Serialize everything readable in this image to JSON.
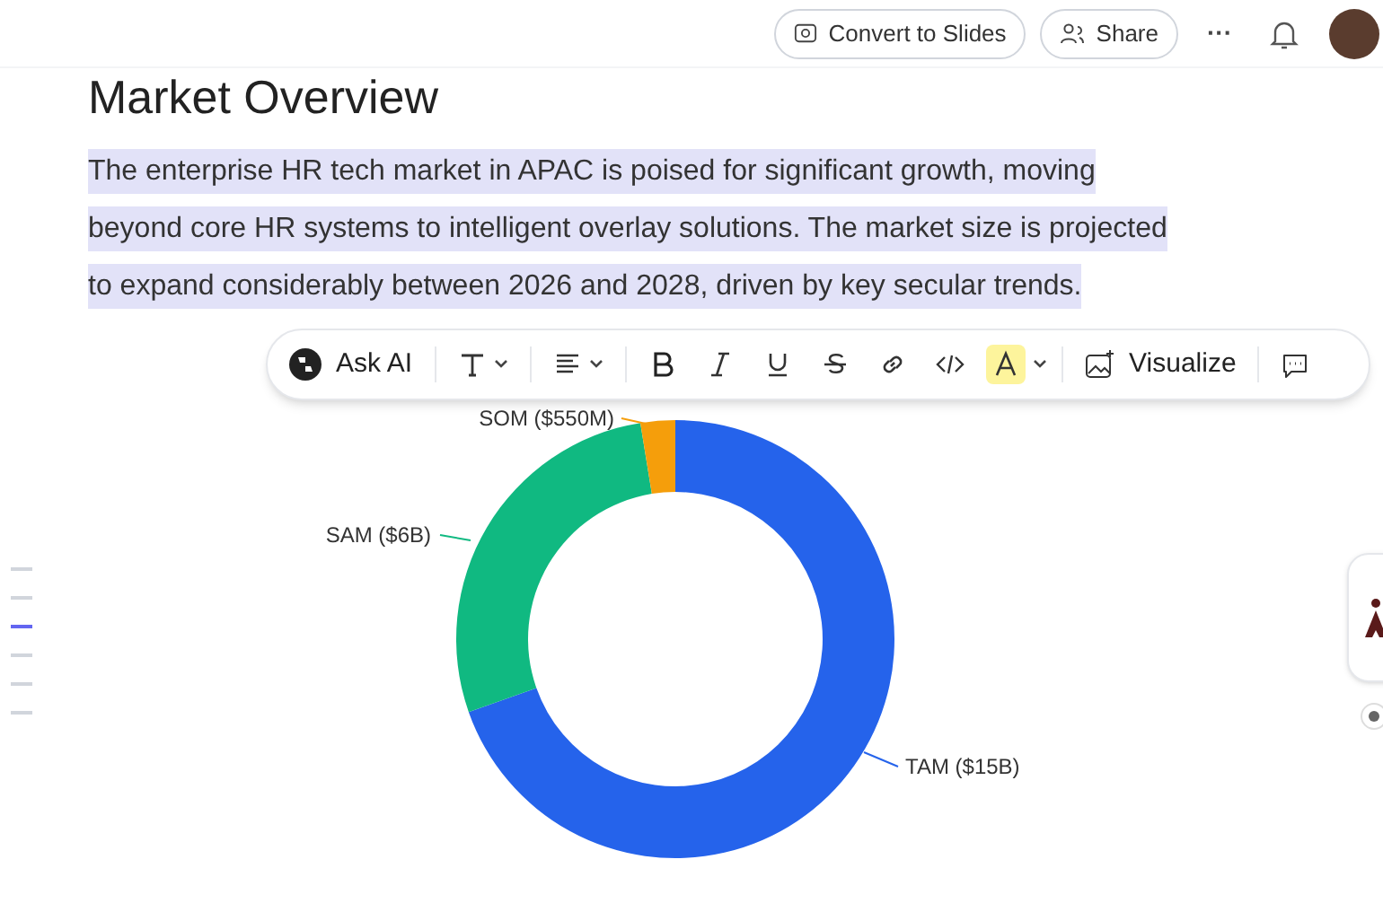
{
  "header": {
    "convert_button": "Convert to Slides",
    "share_button": "Share",
    "more_button": "···"
  },
  "document": {
    "heading": "Market Overview",
    "paragraph": "The enterprise HR tech market in APAC is poised for significant growth, moving beyond core HR systems to intelligent overlay solutions. The market size is projected to expand considerably between 2026 and 2028, driven by key secular trends.",
    "paragraph_selected": true
  },
  "toolbar": {
    "ask_ai": "Ask AI",
    "tools": [
      {
        "kind": "text-style"
      },
      {
        "kind": "align"
      },
      {
        "kind": "bold"
      },
      {
        "kind": "italic"
      },
      {
        "kind": "underline"
      },
      {
        "kind": "strike"
      },
      {
        "kind": "link"
      },
      {
        "kind": "code"
      },
      {
        "kind": "highlight",
        "active": true
      }
    ],
    "visualize": "Visualize"
  },
  "outline": [
    {
      "selected": false
    },
    {
      "selected": false
    },
    {
      "selected": true
    },
    {
      "selected": false
    },
    {
      "selected": false
    },
    {
      "selected": false
    }
  ],
  "chart_data": {
    "type": "donut",
    "categories": [
      "TAM ($15B)",
      "SAM ($6B)",
      "SOM ($550M)"
    ],
    "values": [
      15,
      6,
      0.55
    ],
    "colors": [
      "#2563eb",
      "#10b981",
      "#f59e0b"
    ]
  }
}
